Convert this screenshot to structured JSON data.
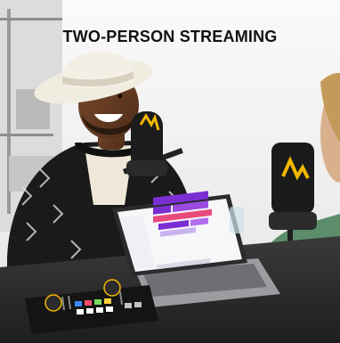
{
  "headline": "TWO-PERSON STREAMING",
  "brand": {
    "mic_logo_color": "#f5b800",
    "device_accent": "#f5b800"
  },
  "colors": {
    "background": "#f3f3f3",
    "desk": "#2b2b2b",
    "laptop_screen_bar_main": "#7b2fd3",
    "laptop_screen_bar_accent": "#e84a7b"
  }
}
